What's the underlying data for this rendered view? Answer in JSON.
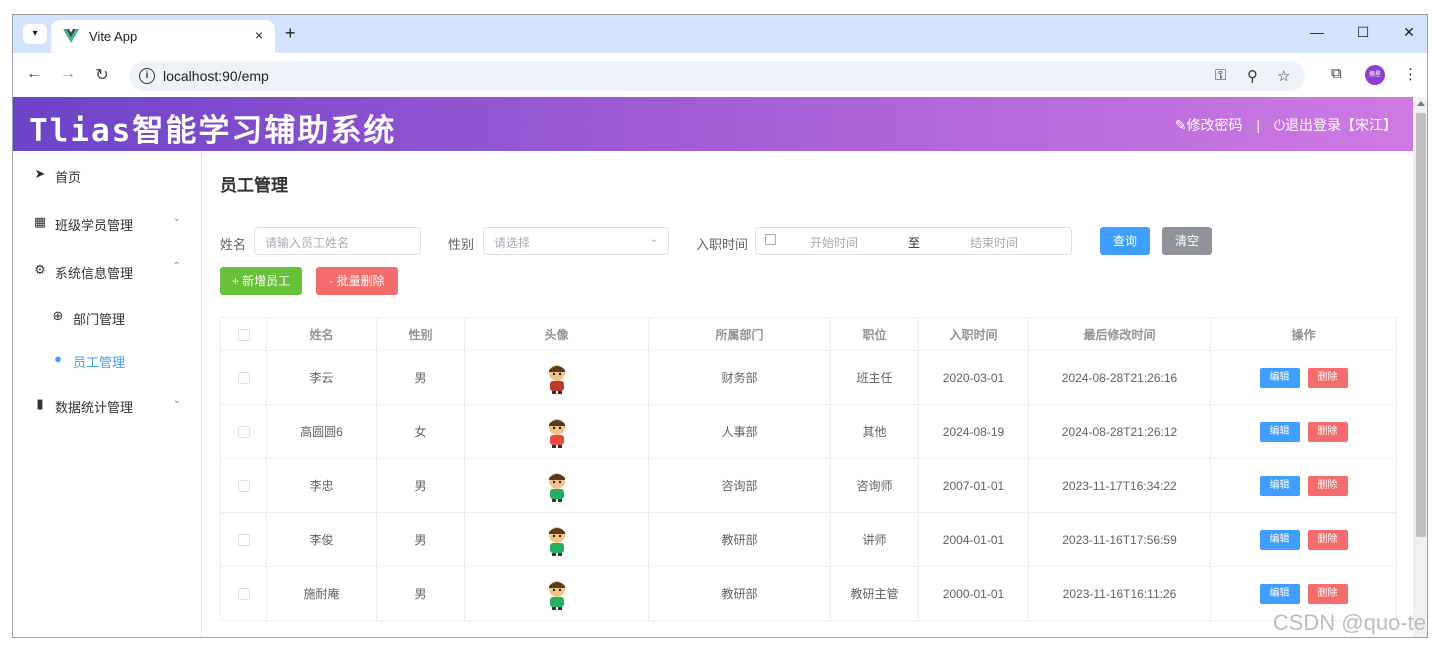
{
  "browser": {
    "tab_title": "Vite App",
    "tab_close": "×",
    "new_tab": "+",
    "url": "localhost:90/emp",
    "controls": {
      "minimize": "—",
      "maximize": "☐",
      "close": "✕"
    },
    "profile_text": "摘星"
  },
  "header": {
    "brand": "Tlias智能学习辅助系统",
    "change_password": "修改密码",
    "separator": "|",
    "logout": "退出登录【宋江】"
  },
  "sidebar": {
    "items": [
      {
        "label": "首页",
        "icon": "send-icon"
      },
      {
        "label": "班级学员管理",
        "icon": "grid-icon",
        "arrow": "⌄"
      },
      {
        "label": "系统信息管理",
        "icon": "gear-icon",
        "arrow": "⌃"
      },
      {
        "label": "部门管理",
        "icon": "circle-plus-icon"
      },
      {
        "label": "员工管理",
        "icon": "user-icon"
      },
      {
        "label": "数据统计管理",
        "icon": "bar-chart-icon",
        "arrow": "⌄"
      }
    ]
  },
  "main": {
    "title": "员工管理",
    "filters": {
      "name_label": "姓名",
      "name_placeholder": "请输入员工姓名",
      "gender_label": "性别",
      "gender_placeholder": "请选择",
      "date_label": "入职时间",
      "start_placeholder": "开始时间",
      "range_separator": "至",
      "end_placeholder": "结束时间",
      "query": "查询",
      "clear": "清空"
    },
    "actions": {
      "add": "+ 新增员工",
      "batch_delete": "- 批量删除"
    },
    "table": {
      "columns": [
        "姓名",
        "性别",
        "头像",
        "所属部门",
        "职位",
        "入职时间",
        "最后修改时间",
        "操作"
      ],
      "edit_label": "编辑",
      "delete_label": "删除",
      "rows": [
        {
          "name": "李云",
          "gender": "男",
          "dept": "财务部",
          "job": "班主任",
          "entry": "2020-03-01",
          "updated": "2024-08-28T21:26:16"
        },
        {
          "name": "高圆圆6",
          "gender": "女",
          "dept": "人事部",
          "job": "其他",
          "entry": "2024-08-19",
          "updated": "2024-08-28T21:26:12"
        },
        {
          "name": "李忠",
          "gender": "男",
          "dept": "咨询部",
          "job": "咨询师",
          "entry": "2007-01-01",
          "updated": "2023-11-17T16:34:22"
        },
        {
          "name": "李俊",
          "gender": "男",
          "dept": "教研部",
          "job": "讲师",
          "entry": "2004-01-01",
          "updated": "2023-11-16T17:56:59"
        },
        {
          "name": "施耐庵",
          "gender": "男",
          "dept": "教研部",
          "job": "教研主管",
          "entry": "2000-01-01",
          "updated": "2023-11-16T16:11:26"
        }
      ]
    }
  },
  "watermark": "CSDN @quo-te",
  "colors": {
    "primary": "#409eff",
    "success": "#67c23a",
    "danger": "#f56c6c",
    "info": "#909399",
    "header_start": "#6d43c8",
    "header_end": "#cf7ae3"
  }
}
